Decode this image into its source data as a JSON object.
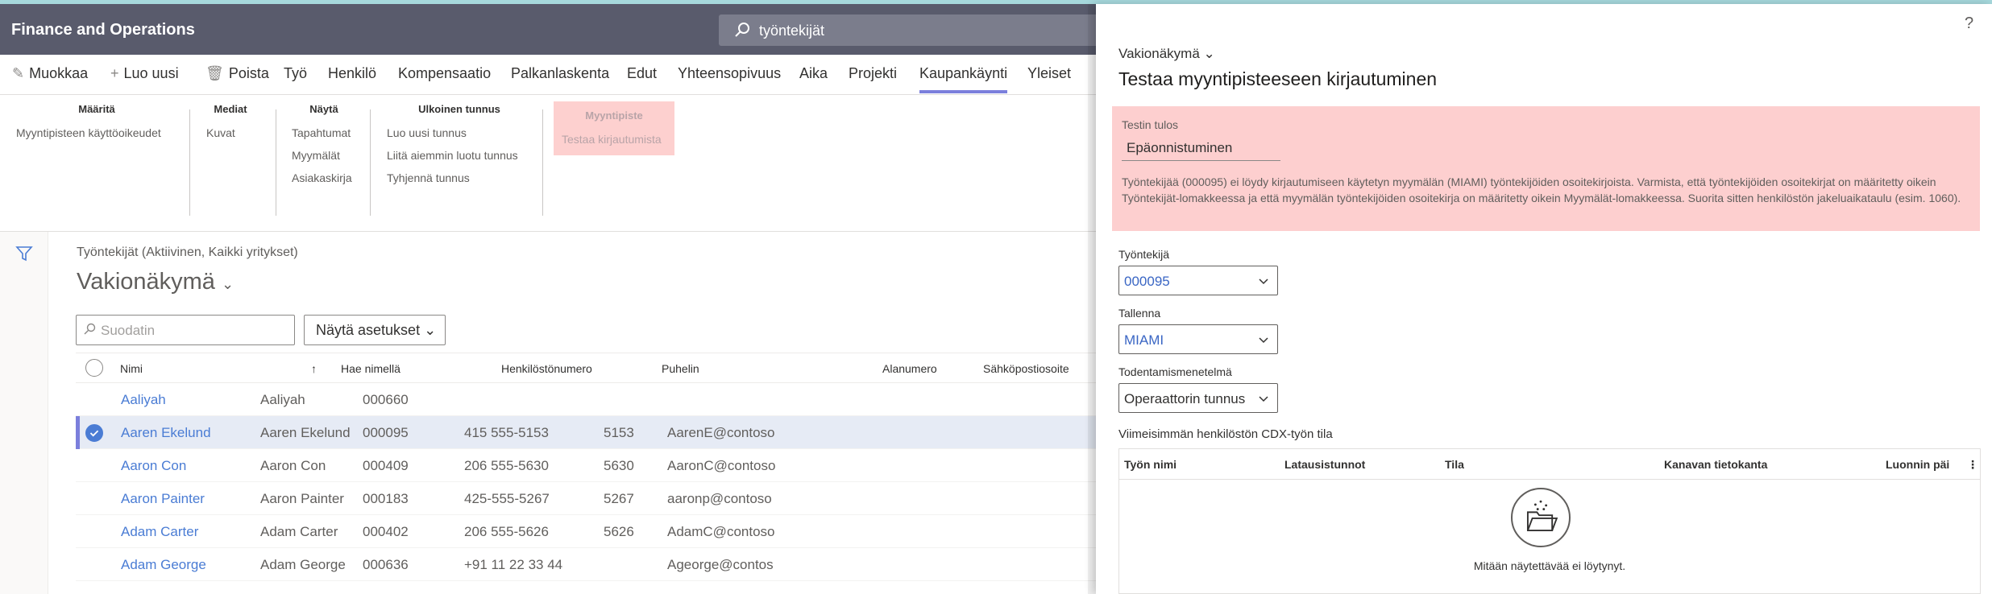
{
  "app": {
    "title": "Finance and Operations",
    "search_value": "työntekijät"
  },
  "actions": {
    "edit": "Muokkaa",
    "new": "Luo uusi",
    "delete": "Poista",
    "tabs": [
      "Työ",
      "Henkilö",
      "Kompensaatio",
      "Palkanlaskenta",
      "Edut",
      "Yhteensopivuus",
      "Aika",
      "Projekti",
      "Kaupankäynti",
      "Yleiset"
    ],
    "selected_tab": "Kaupankäynti"
  },
  "ribbon": {
    "maarita": {
      "header": "Määritä",
      "items": [
        "Myyntipisteen käyttöoikeudet"
      ]
    },
    "mediat": {
      "header": "Mediat",
      "items": [
        "Kuvat"
      ]
    },
    "nayta": {
      "header": "Näytä",
      "items": [
        "Tapahtumat",
        "Myymälät",
        "Asiakaskirja"
      ]
    },
    "ulkoinen": {
      "header": "Ulkoinen tunnus",
      "items": [
        "Luo uusi tunnus",
        "Liitä aiemmin luotu tunnus",
        "Tyhjennä tunnus"
      ]
    },
    "myyntipiste": {
      "header": "Myyntipiste",
      "items": [
        "Testaa kirjautumista"
      ]
    }
  },
  "list": {
    "subtitle": "Työntekijät (Aktiivinen, Kaikki yritykset)",
    "view_name": "Vakionäkymä",
    "filter_placeholder": "Suodatin",
    "show_options": "Näytä asetukset",
    "columns": [
      "Nimi",
      "Hae nimellä",
      "Henkilöstönumero",
      "Puhelin",
      "Alanumero",
      "Sähköpostiosoite"
    ],
    "rows": [
      [
        "Aaliyah",
        "Aaliyah",
        "000660",
        "",
        "",
        ""
      ],
      [
        "Aaren Ekelund",
        "Aaren Ekelund",
        "000095",
        "415 555-5153",
        "5153",
        "AarenE@contoso"
      ],
      [
        "Aaron Con",
        "Aaron Con",
        "000409",
        "206 555-5630",
        "5630",
        "AaronC@contoso"
      ],
      [
        "Aaron Painter",
        "Aaron Painter",
        "000183",
        "425-555-5267",
        "5267",
        "aaronp@contoso"
      ],
      [
        "Adam Carter",
        "Adam Carter",
        "000402",
        "206 555-5626",
        "5626",
        "AdamC@contoso"
      ],
      [
        "Adam George",
        "Adam George",
        "000636",
        "+91 11 22 33 44",
        "",
        "Ageorge@contos"
      ]
    ],
    "selected_row_index": 1
  },
  "panel": {
    "help": "?",
    "view": "Vakionäkymä",
    "title": "Testaa myyntipisteeseen kirjautuminen",
    "result_label": "Testin tulos",
    "result_value": "Epäonnistuminen",
    "result_message": "Työntekijää (000095) ei löydy kirjautumiseen käytetyn myymälän (MIAMI) työntekijöiden osoitekirjoista. Varmista, että työntekijöiden osoitekirjat on määritetty oikein Työntekijät-lomakkeessa ja että myymälän työntekijöiden osoitekirja on määritetty oikein Myymälät-lomakkeessa. Suorita sitten henkilöstön jakeluaikataulu (esim. 1060).",
    "worker_label": "Työntekijä",
    "worker_value": "000095",
    "store_label": "Tallenna",
    "store_value": "MIAMI",
    "auth_label": "Todentamismenetelmä",
    "auth_value": "Operaattorin tunnus",
    "cdx_title": "Viimeisimmän henkilöstön CDX-työn tila",
    "cdx_columns": [
      "Työn nimi",
      "Latausistunnot",
      "Tila",
      "Kanavan tietokanta",
      "Luonnin päi"
    ],
    "empty_text": "Mitään näytettävää ei löytynyt."
  },
  "colors": {
    "topbar": "#595b6c",
    "accent": "#7b7fdc",
    "link": "#4a7cd4",
    "error_bg": "#fdcfcf"
  }
}
